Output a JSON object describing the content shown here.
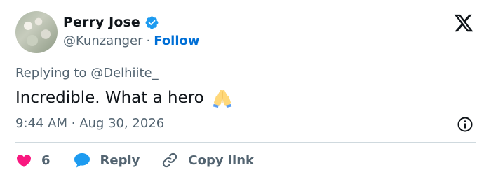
{
  "author": {
    "name": "Perry Jose",
    "handle": "@Kunzanger",
    "separator": "·",
    "follow_label": "Follow",
    "verified_color": "#1d9bf0"
  },
  "reply_context": {
    "prefix": "Replying to ",
    "mention": "@Delhiite_"
  },
  "tweet": {
    "text": "Incredible. What a hero",
    "emoji": "folded-hands"
  },
  "meta": {
    "time": "9:44 AM",
    "separator": "·",
    "date": "Aug 30, 2026"
  },
  "actions": {
    "like_count": "6",
    "reply_label": "Reply",
    "copy_link_label": "Copy link"
  },
  "colors": {
    "text": "#0f1419",
    "secondary": "#536471",
    "link": "#006fd6",
    "like": "#f91880",
    "reply": "#1d9bf0",
    "divider": "#cfd9de"
  }
}
